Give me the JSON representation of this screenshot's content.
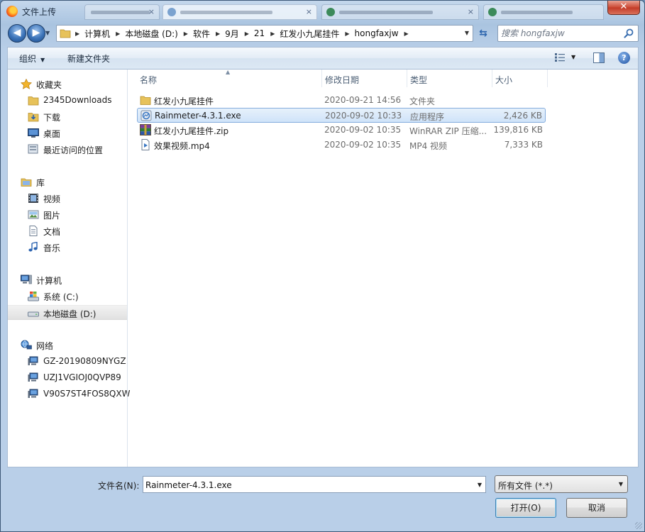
{
  "window": {
    "title": "文件上传",
    "close_label": "✕"
  },
  "nav": {
    "back_glyph": "◀",
    "forward_glyph": "▶",
    "breadcrumbs": [
      "计算机",
      "本地磁盘 (D:)",
      "软件",
      "9月",
      "21",
      "红发小九尾挂件",
      "hongfaxjw"
    ],
    "search_placeholder": "搜索 hongfaxjw"
  },
  "toolbar": {
    "organize_label": "组织",
    "new_folder_label": "新建文件夹",
    "help_glyph": "?"
  },
  "sidebar": {
    "favorites": {
      "header": "收藏夹",
      "items": [
        "2345Downloads",
        "下载",
        "桌面",
        "最近访问的位置"
      ]
    },
    "libraries": {
      "header": "库",
      "items": [
        "视频",
        "图片",
        "文档",
        "音乐"
      ]
    },
    "computer": {
      "header": "计算机",
      "items": [
        "系统 (C:)",
        "本地磁盘 (D:)"
      ]
    },
    "network": {
      "header": "网络",
      "items": [
        "GZ-20190809NYGZ",
        "UZJ1VGIOJ0QVP89",
        "V90S7ST4FOS8QXW"
      ]
    },
    "selected_item": "本地磁盘 (D:)"
  },
  "file_list": {
    "columns": [
      "名称",
      "修改日期",
      "类型",
      "大小"
    ],
    "rows": [
      {
        "name": "红发小九尾挂件",
        "date": "2020-09-21 14:56",
        "type": "文件夹",
        "size": "",
        "icon": "folder-icon"
      },
      {
        "name": "Rainmeter-4.3.1.exe",
        "date": "2020-09-02 10:33",
        "type": "应用程序",
        "size": "2,426 KB",
        "icon": "exe-icon"
      },
      {
        "name": "红发小九尾挂件.zip",
        "date": "2020-09-02 10:35",
        "type": "WinRAR ZIP 压缩...",
        "size": "139,816 KB",
        "icon": "winrar-icon"
      },
      {
        "name": "效果视频.mp4",
        "date": "2020-09-02 10:35",
        "type": "MP4 视频",
        "size": "7,333 KB",
        "icon": "video-file-icon"
      }
    ],
    "selected_row": "Rainmeter-4.3.1.exe"
  },
  "bottom": {
    "filename_label": "文件名(N):",
    "filename_value": "Rainmeter-4.3.1.exe",
    "filetype_value": "所有文件 (*.*)",
    "open_label": "打开(O)",
    "cancel_label": "取消"
  },
  "colors": {
    "selection_bg": "#cfe3f9",
    "selection_border": "#84acdd",
    "chrome": "#b9cfe8"
  }
}
